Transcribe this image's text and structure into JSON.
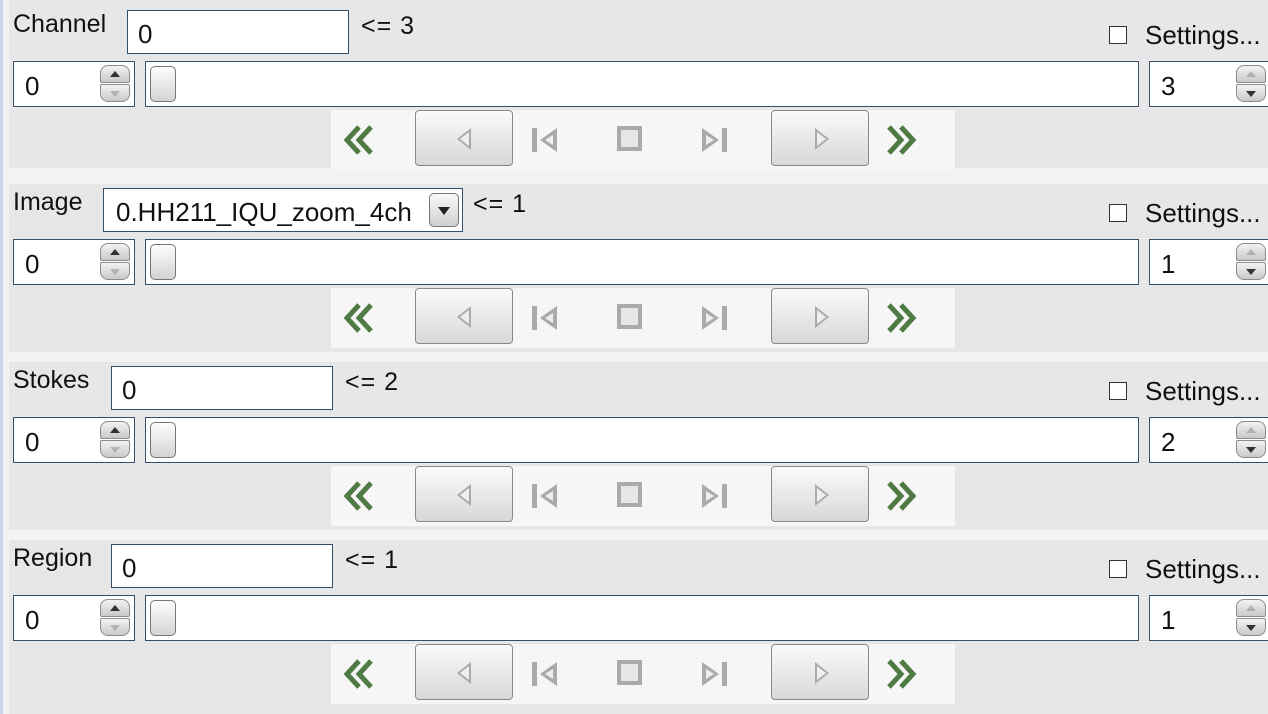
{
  "panels": [
    {
      "key": "channel",
      "title": "Channel",
      "input_value": "0",
      "limit": "<= 3",
      "settings_label": "Settings...",
      "settings_checked": false,
      "min_value": "0",
      "max_value": "3"
    },
    {
      "key": "image",
      "title": "Image",
      "input_value": "0.HH211_IQU_zoom_4ch",
      "limit": "<= 1",
      "settings_label": "Settings...",
      "settings_checked": false,
      "min_value": "0",
      "max_value": "1"
    },
    {
      "key": "stokes",
      "title": "Stokes",
      "input_value": "0",
      "limit": "<= 2",
      "settings_label": "Settings...",
      "settings_checked": false,
      "min_value": "0",
      "max_value": "2"
    },
    {
      "key": "region",
      "title": "Region",
      "input_value": "0",
      "limit": "<= 1",
      "settings_label": "Settings...",
      "settings_checked": false,
      "min_value": "0",
      "max_value": "1"
    }
  ],
  "controls": [
    "rewind-icon",
    "step-back-button",
    "skip-to-start-icon",
    "stop-icon",
    "skip-to-end-icon",
    "play-button",
    "fast-forward-icon"
  ],
  "colors": {
    "panel_bg": "#e7e7e7",
    "field_border": "#35506b",
    "control_green": "#4f7a43"
  }
}
